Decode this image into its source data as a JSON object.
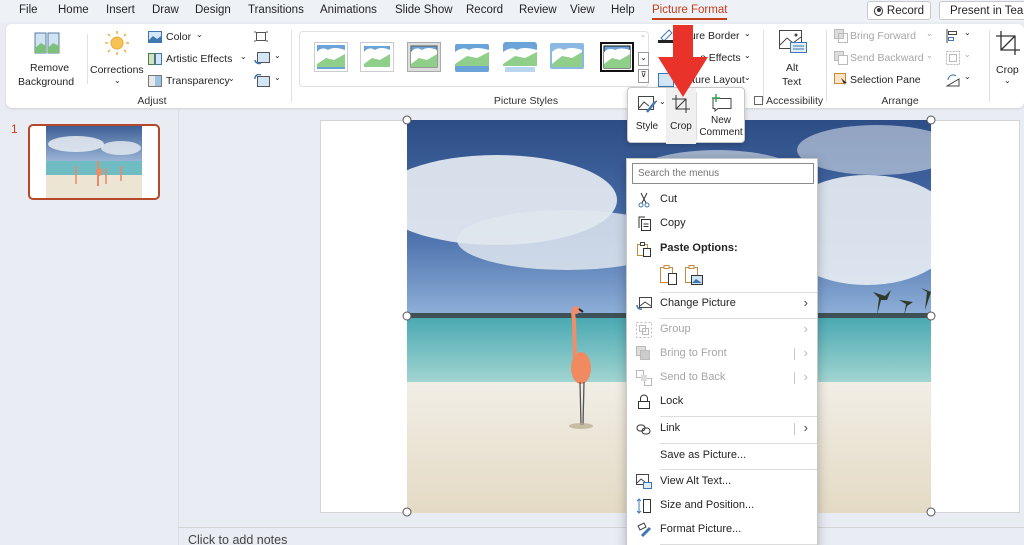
{
  "tabs": [
    {
      "label": "File"
    },
    {
      "label": "Home"
    },
    {
      "label": "Insert"
    },
    {
      "label": "Draw"
    },
    {
      "label": "Design"
    },
    {
      "label": "Transitions"
    },
    {
      "label": "Animations"
    },
    {
      "label": "Slide Show"
    },
    {
      "label": "Record"
    },
    {
      "label": "Review"
    },
    {
      "label": "View"
    },
    {
      "label": "Help"
    },
    {
      "label": "Picture Format",
      "active": true
    }
  ],
  "titlebar_buttons": {
    "record": "Record",
    "present": "Present in Teams"
  },
  "ribbon": {
    "adjust": {
      "remove_background": [
        "Remove",
        "Background"
      ],
      "corrections": "Corrections",
      "color": "Color",
      "artistic_effects": "Artistic Effects",
      "transparency": "Transparency",
      "label": "Adjust"
    },
    "picture_styles": {
      "label": "Picture Styles",
      "border": "Picture Border",
      "effects": "Picture Effects",
      "layout": "Picture Layout",
      "border_visible": "ture Border",
      "effects_visible": "e Effects",
      "layout_visible": "cture Layout"
    },
    "accessibility": {
      "alt_text": [
        "Alt",
        "Text"
      ],
      "label": "Accessibility"
    },
    "arrange": {
      "bring_forward": "Bring Forward",
      "send_backward": "Send Backward",
      "selection_pane": "Selection Pane",
      "label": "Arrange"
    },
    "size": {
      "crop": "Crop"
    }
  },
  "slides": {
    "current_number": "1"
  },
  "notes_placeholder": "Click to add notes",
  "mini_toolbar": {
    "style": "Style",
    "crop": "Crop",
    "new_comment": [
      "New",
      "Comment"
    ]
  },
  "context_menu": {
    "search_placeholder": "Search the menus",
    "items": [
      {
        "label": "Cut",
        "icon": "scissors-icon",
        "enabled": true
      },
      {
        "label": "Copy",
        "icon": "copy-icon",
        "enabled": true
      },
      {
        "label": "Paste Options:",
        "icon": "paste-icon",
        "enabled": true,
        "bold": true
      },
      {
        "label": "Change Picture",
        "icon": "change-picture-icon",
        "enabled": true,
        "submenu": true
      },
      {
        "label": "Group",
        "icon": "group-icon",
        "enabled": false,
        "submenu": true
      },
      {
        "label": "Bring to Front",
        "icon": "bring-front-icon",
        "enabled": false,
        "submenu": true
      },
      {
        "label": "Send to Back",
        "icon": "send-back-icon",
        "enabled": false,
        "submenu": true
      },
      {
        "label": "Lock",
        "icon": "lock-icon",
        "enabled": true
      },
      {
        "label": "Link",
        "icon": "link-icon",
        "enabled": true,
        "submenu": true
      },
      {
        "label": "Save as Picture...",
        "enabled": true
      },
      {
        "label": "View Alt Text...",
        "icon": "alt-text-icon",
        "enabled": true
      },
      {
        "label": "Size and Position...",
        "icon": "size-position-icon",
        "enabled": true
      },
      {
        "label": "Format Picture...",
        "icon": "format-picture-icon",
        "enabled": true
      }
    ]
  },
  "colors": {
    "accent": "#c43e1c",
    "arrow": "#e8322a"
  }
}
